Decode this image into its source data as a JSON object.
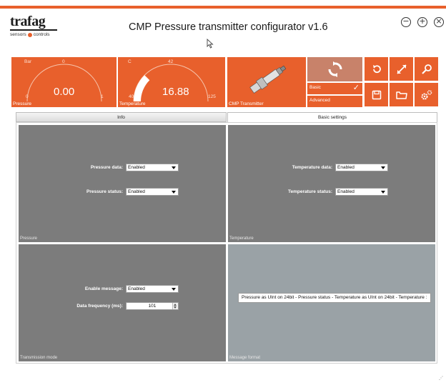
{
  "app": {
    "logo_word": "trafag",
    "logo_tagline_left": "sensors",
    "logo_tagline_right": "controls",
    "title": "CMP Pressure transmitter configurator v1.6",
    "accent_color": "#e8602c"
  },
  "window_controls": {
    "minimize_icon": "minus-circle-icon",
    "maximize_icon": "plus-circle-icon",
    "close_icon": "x-circle-icon",
    "minimize_glyph": "−",
    "maximize_glyph": "+",
    "close_glyph": "×"
  },
  "gauges": {
    "pressure": {
      "unit": "Bar",
      "min": "0",
      "mid": "0",
      "max": "1",
      "value": "0.00",
      "fill_fraction": 0.0,
      "caption": "Pressure"
    },
    "temperature": {
      "unit": "C",
      "min": "40",
      "mid": "42",
      "max": "125",
      "value": "16.88",
      "fill_fraction": 0.25,
      "caption": "Temperature"
    }
  },
  "transmitter_tile": {
    "caption": "CMP Transmitter",
    "image_icon": "pressure-transmitter-icon"
  },
  "mode": {
    "refresh_icon": "sync-arrows-icon",
    "basic_label": "Basic",
    "advanced_label": "Advanced",
    "selected": "Basic",
    "check_glyph": "✓"
  },
  "toolbar": {
    "reset_icon": "undo-arrow-icon",
    "connect_icon": "arrows-expand-icon",
    "search_icon": "magnifier-icon",
    "save_icon": "floppy-disk-icon",
    "open_icon": "folder-icon",
    "settings_icon": "gears-icon"
  },
  "tabs": [
    {
      "label": "Info",
      "active": false
    },
    {
      "label": "Basic settings",
      "active": true
    }
  ],
  "pressure_panel": {
    "caption": "Pressure",
    "data_label": "Pressure data:",
    "data_value": "Enabled",
    "status_label": "Pressure status:",
    "status_value": "Enabled"
  },
  "temperature_panel": {
    "caption": "Temperature",
    "data_label": "Temperature data:",
    "data_value": "Enabled",
    "status_label": "Temperature status:",
    "status_value": "Enabled"
  },
  "transmission_panel": {
    "caption": "Transmission mode",
    "enable_label": "Enable message:",
    "enable_value": "Enabled",
    "frequency_label": "Data frequency (ms):",
    "frequency_value": "101"
  },
  "message_panel": {
    "caption": "Message format",
    "format_text": "Pressure as UInt on 24bit - Pressure status - Temperature as UInt on 24bit - Temperature :"
  }
}
